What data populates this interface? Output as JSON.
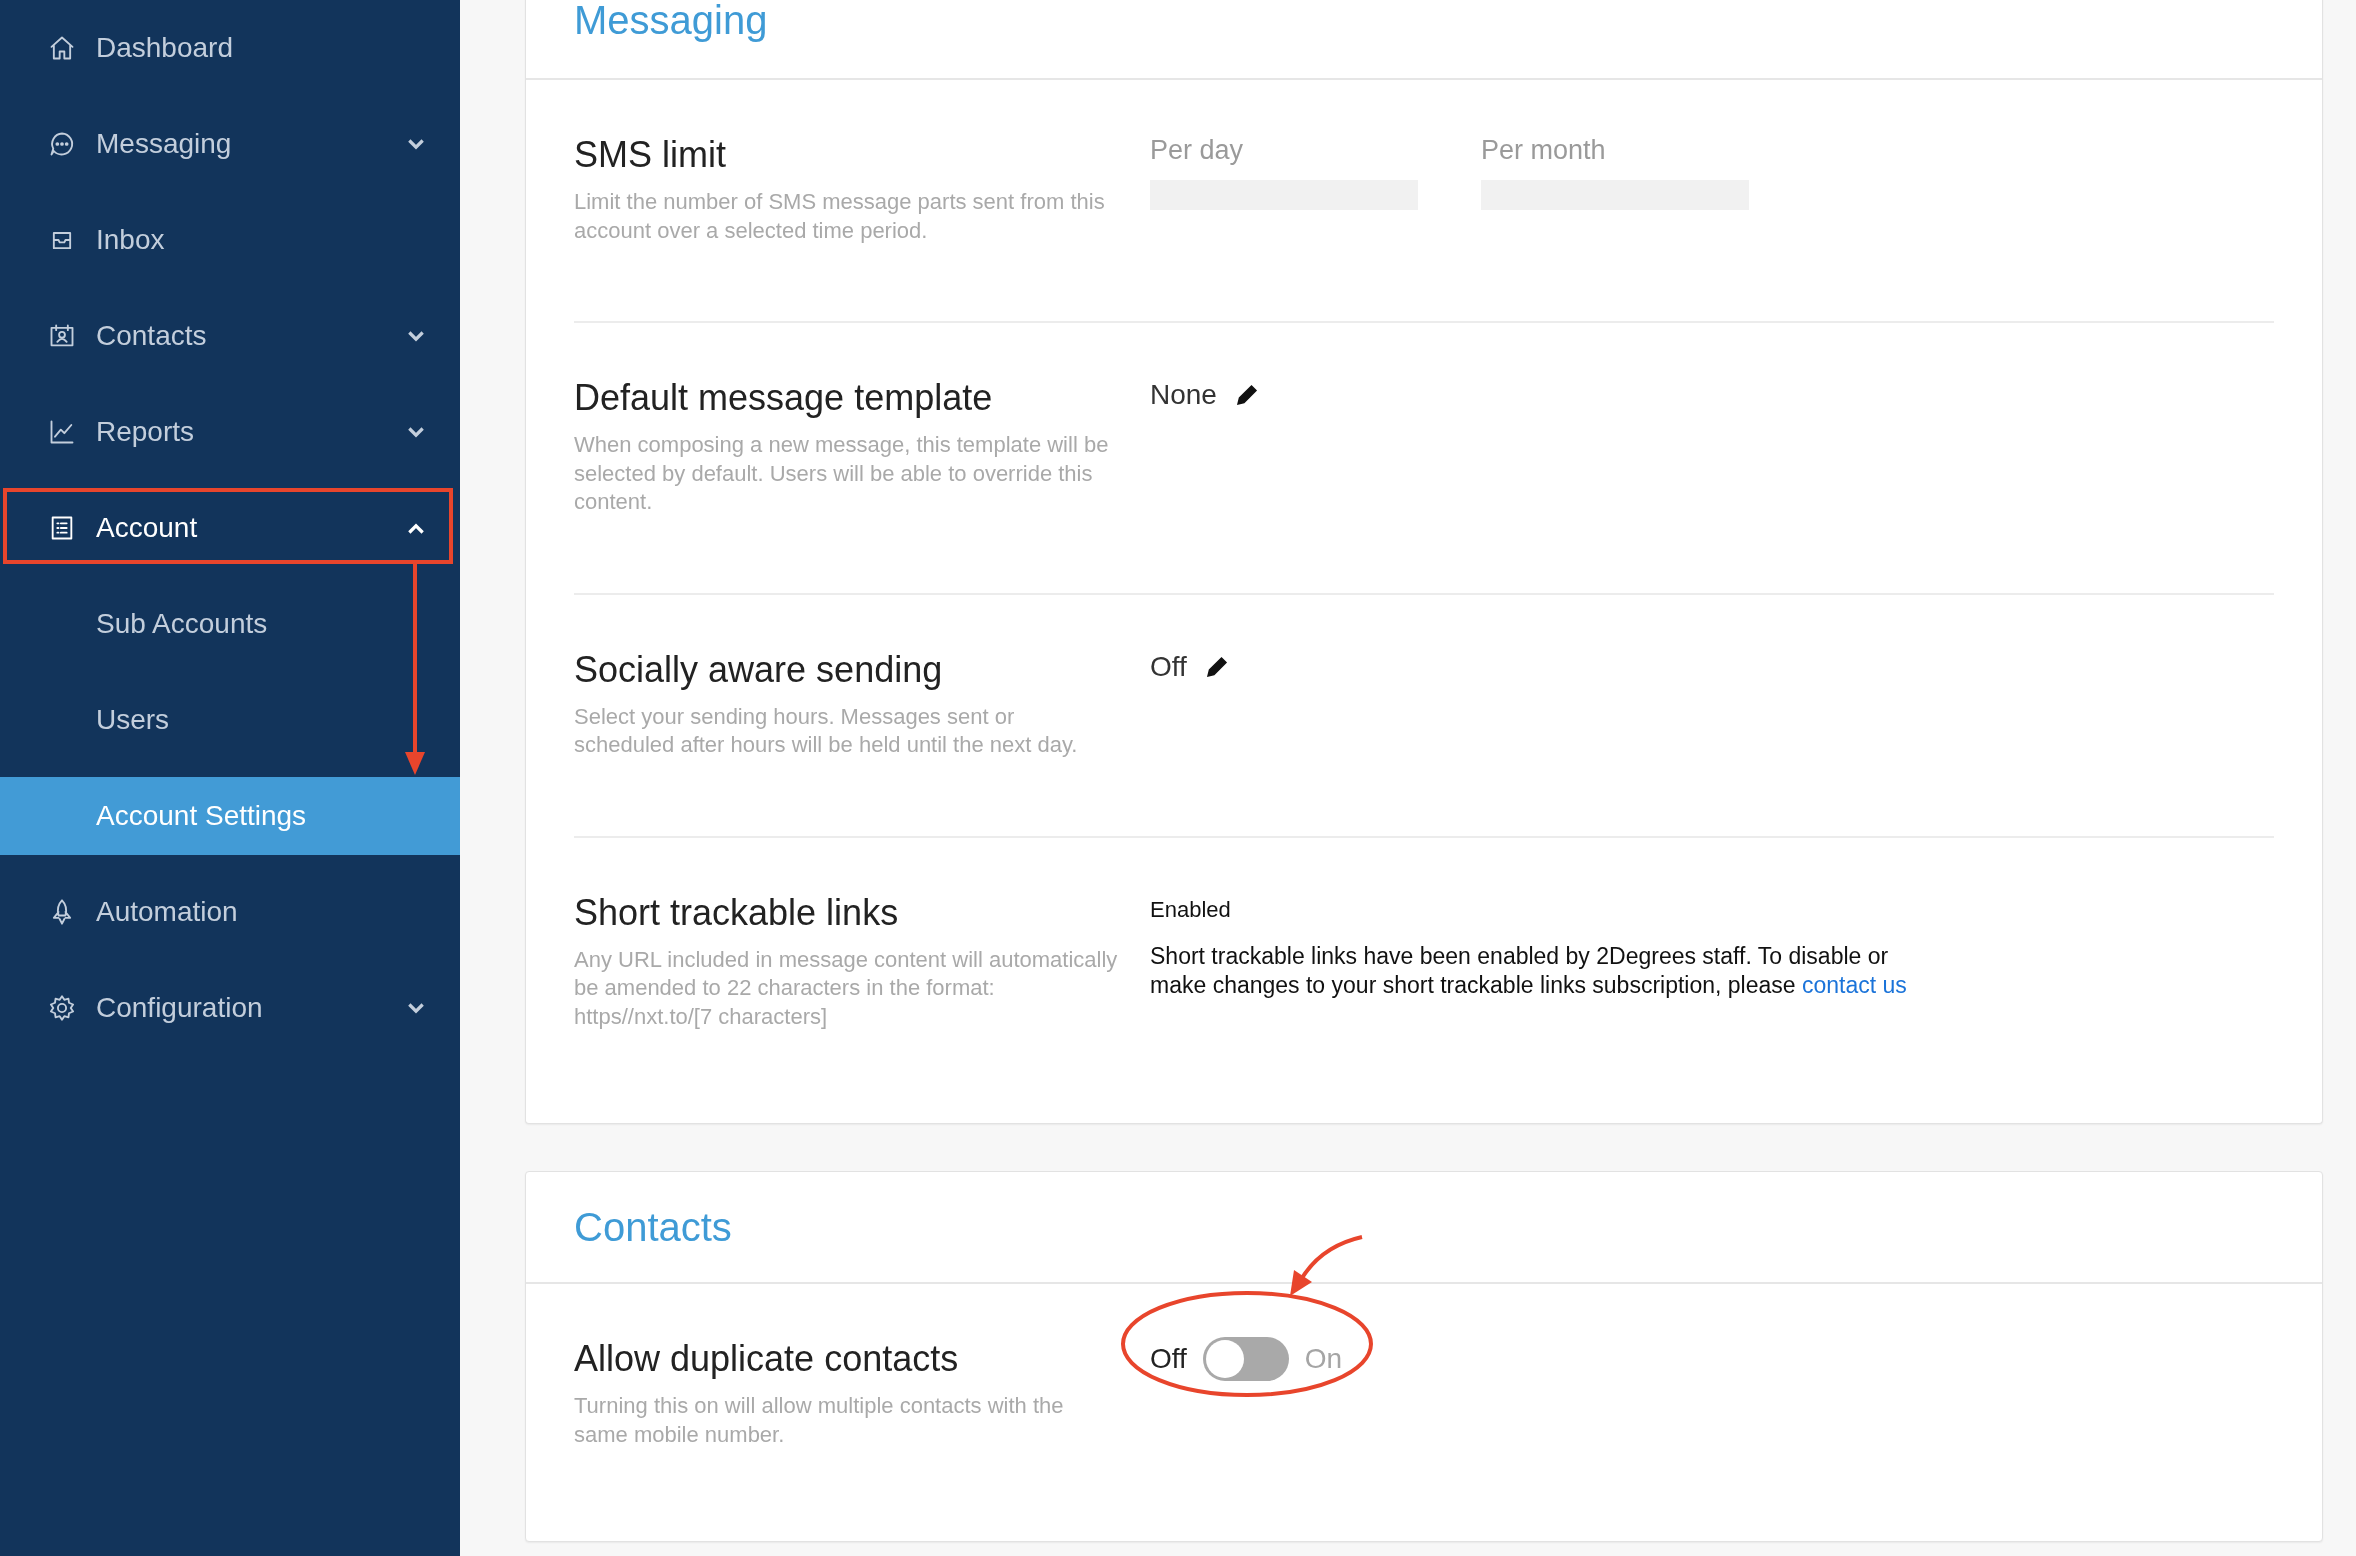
{
  "sidebar": {
    "items": [
      {
        "label": "Dashboard",
        "expandable": false,
        "expanded": false
      },
      {
        "label": "Messaging",
        "expandable": true,
        "expanded": false
      },
      {
        "label": "Inbox",
        "expandable": false,
        "expanded": false
      },
      {
        "label": "Contacts",
        "expandable": true,
        "expanded": false
      },
      {
        "label": "Reports",
        "expandable": true,
        "expanded": false
      },
      {
        "label": "Account",
        "expandable": true,
        "expanded": true,
        "children": [
          {
            "label": "Sub Accounts",
            "selected": false
          },
          {
            "label": "Users",
            "selected": false
          },
          {
            "label": "Account Settings",
            "selected": true
          }
        ]
      },
      {
        "label": "Automation",
        "expandable": false,
        "expanded": false
      },
      {
        "label": "Configuration",
        "expandable": true,
        "expanded": false
      }
    ]
  },
  "sections": [
    {
      "title": "Messaging",
      "rows": [
        {
          "kind": "limits",
          "title": "SMS limit",
          "description": "Limit the number of SMS message parts sent from this account over a selected time period.",
          "fields": [
            {
              "label": "Per day"
            },
            {
              "label": "Per month"
            }
          ]
        },
        {
          "kind": "editable",
          "title": "Default message template",
          "description": "When composing a new message, this template will be selected by default. Users will be able to override this content.",
          "value": "None"
        },
        {
          "kind": "editable",
          "title": "Socially aware sending",
          "description": "Select your sending hours. Messages sent or scheduled after hours will be held until the next day.",
          "value": "Off"
        },
        {
          "kind": "info",
          "title": "Short trackable links",
          "description": "Any URL included in message content will automatically be amended to 22 characters in the format: https//nxt.to/[7 characters]",
          "status": "Enabled",
          "message": "Short trackable links have been enabled by 2Degrees staff. To disable or make changes to your short trackable links subscription, please",
          "link": "contact us"
        }
      ]
    },
    {
      "title": "Contacts",
      "rows": [
        {
          "kind": "toggle",
          "title": "Allow duplicate contacts",
          "description": "Turning this on will allow multiple contacts with the same mobile number.",
          "off_label": "Off",
          "on_label": "On",
          "on": false
        }
      ]
    }
  ]
}
